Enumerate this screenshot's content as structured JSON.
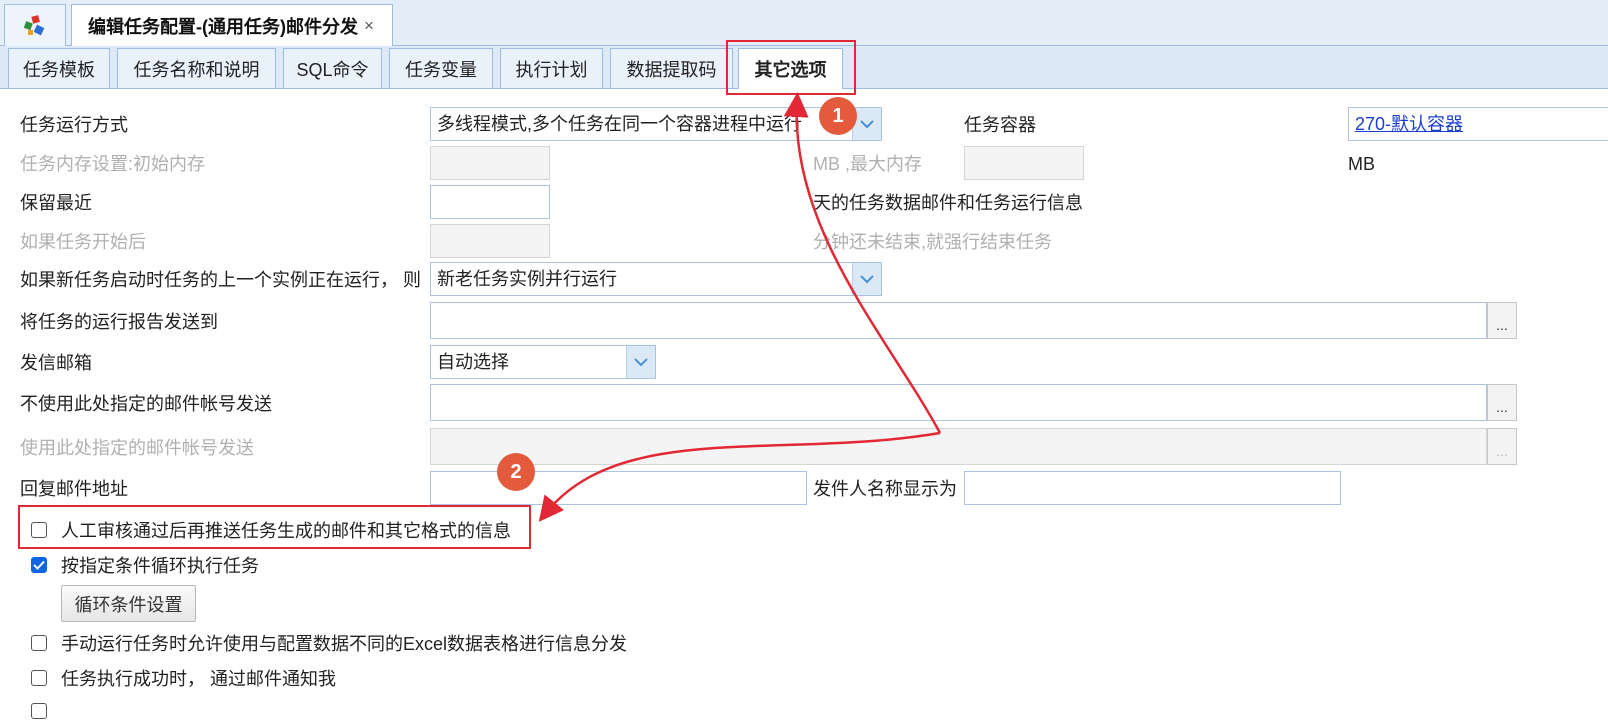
{
  "window": {
    "home_icon": "app-logo-icon",
    "doc_tab_title": "编辑任务配置-(通用任务)邮件分发",
    "doc_tab_close": "×"
  },
  "tabs": [
    {
      "label": "任务模板",
      "active": false
    },
    {
      "label": "任务名称和说明",
      "active": false
    },
    {
      "label": "SQL命令",
      "active": false
    },
    {
      "label": "任务变量",
      "active": false
    },
    {
      "label": "执行计划",
      "active": false
    },
    {
      "label": "数据提取码",
      "active": false
    },
    {
      "label": "其它选项",
      "active": true
    }
  ],
  "form": {
    "run_mode_label": "任务运行方式",
    "run_mode_value": "多线程模式,多个任务在同一个容器进程中运行",
    "container_label": "任务容器",
    "container_value": "270-默认容器",
    "memory_label": "任务内存设置:初始内存",
    "memory_max_label": "MB ,最大内存",
    "memory_unit": "MB",
    "keep_label": "保留最近",
    "keep_suffix": "天的任务数据邮件和任务运行信息",
    "timeout_label": "如果任务开始后",
    "timeout_suffix": "分钟还未结束,就强行结束任务",
    "overlap_label": "如果新任务启动时任务的上一个实例正在运行， 则",
    "overlap_value": "新老任务实例并行运行",
    "report_label": "将任务的运行报告发送到",
    "sender_label": "发信邮箱",
    "sender_value": "自动选择",
    "exclude_label": "不使用此处指定的邮件帐号发送",
    "include_label": "使用此处指定的邮件帐号发送",
    "reply_label": "回复邮件地址",
    "sender_name_label": "发件人名称显示为",
    "browse_label": "..."
  },
  "options": [
    {
      "label": "人工审核通过后再推送任务生成的邮件和其它格式的信息",
      "checked": false
    },
    {
      "label": "按指定条件循环执行任务",
      "checked": true
    },
    {
      "label": "手动运行任务时允许使用与配置数据不同的Excel数据表格进行信息分发",
      "checked": false
    },
    {
      "label": "任务执行成功时， 通过邮件通知我",
      "checked": false
    }
  ],
  "loop_button": "循环条件设置",
  "annotations": {
    "badge_1": "1",
    "badge_2": "2",
    "accent_color": "#e12834"
  }
}
